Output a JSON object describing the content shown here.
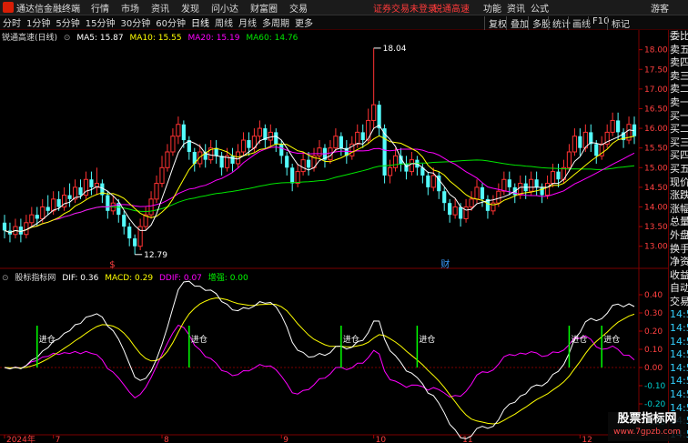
{
  "app": {
    "title": "通达信金融终端",
    "menu": [
      "行情",
      "市场",
      "资讯",
      "发现",
      "问小达",
      "财富圈",
      "交易"
    ],
    "notice": "证券交易未登录",
    "notice2": "锐通高速",
    "right_menu": [
      "功能",
      "资讯",
      "公式",
      "游客"
    ]
  },
  "toolbar": {
    "periods": [
      "分时",
      "1分钟",
      "5分钟",
      "15分钟",
      "30分钟",
      "60分钟",
      "日线",
      "周线",
      "月线",
      "多周期",
      "更多"
    ],
    "active": "日线",
    "right": [
      "复权",
      "叠加",
      "多股",
      "统计",
      "画线",
      "F10",
      "标记"
    ]
  },
  "legend_main": {
    "name": "锐通高速(日线)",
    "ma5": "MA5: 15.87",
    "ma10": "MA10: 15.55",
    "ma20": "MA20: 15.19",
    "ma60": "MA60: 14.76"
  },
  "legend_sub": {
    "name": "股标指标网",
    "dif": "DIF: 0.36",
    "macd": "MACD: 0.29",
    "ddif": "DDIF: 0.07",
    "zq": "增强: 0.00"
  },
  "right_panel": [
    "委比",
    "卖五",
    "卖四",
    "卖三",
    "卖二",
    "卖一",
    "买一",
    "买二",
    "买三",
    "买四",
    "买五",
    "现价",
    "涨跌",
    "涨幅",
    "总量",
    "外盘",
    "换手",
    "净资",
    "收益",
    "自动",
    "交易",
    "14:5",
    "14:5",
    "14:5",
    "14:5",
    "14:5",
    "14:5",
    "14:5",
    "14:5",
    "14:5",
    "14:5"
  ],
  "watermark": {
    "line1": "股票指标网",
    "line2": "www.7gpzb.com"
  },
  "colors": {
    "up": "#ff3232",
    "down": "#54fcfc",
    "ma5": "#ffffff",
    "ma10": "#ffff00",
    "ma20": "#ff00ff",
    "ma60": "#00e600",
    "dif": "#ffffff",
    "dea": "#ffff00",
    "ddif": "#ff00ff",
    "signal": "#00ff00"
  },
  "chart_data": {
    "type": "candlestick",
    "y_ticks": [
      "18.00",
      "17.50",
      "17.00",
      "16.50",
      "16.00",
      "15.50",
      "15.00",
      "14.50",
      "14.00",
      "13.50",
      "13.00"
    ],
    "ylim": [
      12.6,
      18.2
    ],
    "x_ticks": [
      {
        "index": 0,
        "label": "2024年"
      },
      {
        "index": 9,
        "label": "7"
      },
      {
        "index": 29,
        "label": "8"
      },
      {
        "index": 51,
        "label": "9"
      },
      {
        "index": 68,
        "label": "10"
      },
      {
        "index": 84,
        "label": "11"
      },
      {
        "index": 106,
        "label": "12"
      }
    ],
    "high_label": {
      "index": 68,
      "value": "18.04"
    },
    "low_label": {
      "index": 24,
      "value": "12.79"
    },
    "event_markers": [
      {
        "index": 20,
        "label": "$"
      },
      {
        "index": 81,
        "label": "财"
      }
    ],
    "candles": [
      [
        13.6,
        13.4,
        13.8,
        13.2
      ],
      [
        13.4,
        13.3,
        13.6,
        13.1
      ],
      [
        13.3,
        13.5,
        13.7,
        13.2
      ],
      [
        13.5,
        13.3,
        13.7,
        13.1
      ],
      [
        13.3,
        13.6,
        13.8,
        13.2
      ],
      [
        13.6,
        13.8,
        14.0,
        13.5
      ],
      [
        13.8,
        13.7,
        14.0,
        13.5
      ],
      [
        13.7,
        14.0,
        14.2,
        13.6
      ],
      [
        14.0,
        13.9,
        14.3,
        13.8
      ],
      [
        13.9,
        14.2,
        14.4,
        13.8
      ],
      [
        14.2,
        14.0,
        14.4,
        13.9
      ],
      [
        14.0,
        14.3,
        14.5,
        13.9
      ],
      [
        14.3,
        14.2,
        14.6,
        14.0
      ],
      [
        14.2,
        14.5,
        14.7,
        14.1
      ],
      [
        14.5,
        14.3,
        14.7,
        14.2
      ],
      [
        14.3,
        14.7,
        14.9,
        14.2
      ],
      [
        14.7,
        14.5,
        14.9,
        14.3
      ],
      [
        14.5,
        14.6,
        15.0,
        14.3
      ],
      [
        14.6,
        14.3,
        14.7,
        14.1
      ],
      [
        14.3,
        13.9,
        14.4,
        13.7
      ],
      [
        13.9,
        14.1,
        14.3,
        13.8
      ],
      [
        14.1,
        13.8,
        14.2,
        13.6
      ],
      [
        13.8,
        13.5,
        13.9,
        13.3
      ],
      [
        13.5,
        13.2,
        13.6,
        13.0
      ],
      [
        13.2,
        13.0,
        13.3,
        12.79
      ],
      [
        13.0,
        13.5,
        13.7,
        12.9
      ],
      [
        13.5,
        13.8,
        14.0,
        13.4
      ],
      [
        13.8,
        14.2,
        14.4,
        13.7
      ],
      [
        14.2,
        14.6,
        14.8,
        14.1
      ],
      [
        14.6,
        15.0,
        15.3,
        14.5
      ],
      [
        15.0,
        15.4,
        15.6,
        14.9
      ],
      [
        15.4,
        15.8,
        16.0,
        15.3
      ],
      [
        15.8,
        16.1,
        16.3,
        15.6
      ],
      [
        16.1,
        15.7,
        16.2,
        15.5
      ],
      [
        15.7,
        15.4,
        15.8,
        15.2
      ],
      [
        15.4,
        15.1,
        15.5,
        14.9
      ],
      [
        15.1,
        15.4,
        15.6,
        15.0
      ],
      [
        15.4,
        15.2,
        15.6,
        15.0
      ],
      [
        15.2,
        15.5,
        15.7,
        15.1
      ],
      [
        15.5,
        15.3,
        15.7,
        15.1
      ],
      [
        15.3,
        15.0,
        15.4,
        14.8
      ],
      [
        15.0,
        15.3,
        15.5,
        14.9
      ],
      [
        15.3,
        15.1,
        15.5,
        14.9
      ],
      [
        15.1,
        15.4,
        15.6,
        15.0
      ],
      [
        15.4,
        15.7,
        15.9,
        15.3
      ],
      [
        15.7,
        15.5,
        15.9,
        15.3
      ],
      [
        15.5,
        15.8,
        16.0,
        15.4
      ],
      [
        15.8,
        16.0,
        16.2,
        15.6
      ],
      [
        16.0,
        15.7,
        16.1,
        15.5
      ],
      [
        15.7,
        15.9,
        16.1,
        15.5
      ],
      [
        15.9,
        15.6,
        16.0,
        15.4
      ],
      [
        15.6,
        15.3,
        15.7,
        15.1
      ],
      [
        15.3,
        15.0,
        15.4,
        14.8
      ],
      [
        15.0,
        14.6,
        15.1,
        14.4
      ],
      [
        14.6,
        14.9,
        15.1,
        14.5
      ],
      [
        14.9,
        15.2,
        15.4,
        14.8
      ],
      [
        15.2,
        15.0,
        15.4,
        14.8
      ],
      [
        15.0,
        15.3,
        15.5,
        14.9
      ],
      [
        15.3,
        15.5,
        15.7,
        15.2
      ],
      [
        15.5,
        15.2,
        15.6,
        15.0
      ],
      [
        15.2,
        15.5,
        15.7,
        15.1
      ],
      [
        15.5,
        15.8,
        16.0,
        15.4
      ],
      [
        15.8,
        15.5,
        15.9,
        15.3
      ],
      [
        15.5,
        15.3,
        15.7,
        15.1
      ],
      [
        15.3,
        15.6,
        15.8,
        15.2
      ],
      [
        15.6,
        15.9,
        16.1,
        15.5
      ],
      [
        15.9,
        15.7,
        16.1,
        15.5
      ],
      [
        15.7,
        16.2,
        16.5,
        15.6
      ],
      [
        16.2,
        16.6,
        18.04,
        16.0
      ],
      [
        16.6,
        16.0,
        16.7,
        15.8
      ],
      [
        16.0,
        14.8,
        16.1,
        14.6
      ],
      [
        14.8,
        15.0,
        15.2,
        14.6
      ],
      [
        15.0,
        15.3,
        15.5,
        14.9
      ],
      [
        15.3,
        15.1,
        15.5,
        14.9
      ],
      [
        15.1,
        14.9,
        15.3,
        14.7
      ],
      [
        14.9,
        15.2,
        15.4,
        14.8
      ],
      [
        15.2,
        15.0,
        15.3,
        14.8
      ],
      [
        15.0,
        14.8,
        15.1,
        14.6
      ],
      [
        14.8,
        14.5,
        14.9,
        14.3
      ],
      [
        14.5,
        14.8,
        15.0,
        14.4
      ],
      [
        14.8,
        14.4,
        14.9,
        14.2
      ],
      [
        14.4,
        14.1,
        14.5,
        13.9
      ],
      [
        14.1,
        13.8,
        14.2,
        13.6
      ],
      [
        13.8,
        14.0,
        14.2,
        13.7
      ],
      [
        14.0,
        13.7,
        14.1,
        13.5
      ],
      [
        13.7,
        14.0,
        14.2,
        13.6
      ],
      [
        14.0,
        14.2,
        14.4,
        13.9
      ],
      [
        14.2,
        14.5,
        14.7,
        14.1
      ],
      [
        14.5,
        14.2,
        14.6,
        14.0
      ],
      [
        14.2,
        13.9,
        14.3,
        13.7
      ],
      [
        13.9,
        14.1,
        14.3,
        13.8
      ],
      [
        14.1,
        14.4,
        14.6,
        14.0
      ],
      [
        14.4,
        14.7,
        14.9,
        14.3
      ],
      [
        14.7,
        14.5,
        14.9,
        14.3
      ],
      [
        14.5,
        14.3,
        14.6,
        14.1
      ],
      [
        14.3,
        14.6,
        14.8,
        14.2
      ],
      [
        14.6,
        14.4,
        14.8,
        14.2
      ],
      [
        14.4,
        14.7,
        14.9,
        14.3
      ],
      [
        14.7,
        14.5,
        14.9,
        14.3
      ],
      [
        14.5,
        14.3,
        14.6,
        14.1
      ],
      [
        14.3,
        14.6,
        14.8,
        14.2
      ],
      [
        14.6,
        14.9,
        15.1,
        14.5
      ],
      [
        14.9,
        14.7,
        15.1,
        14.5
      ],
      [
        14.7,
        15.0,
        15.2,
        14.6
      ],
      [
        15.0,
        15.4,
        15.6,
        14.9
      ],
      [
        15.4,
        15.8,
        16.0,
        15.3
      ],
      [
        15.8,
        15.5,
        16.0,
        15.3
      ],
      [
        15.5,
        15.9,
        16.1,
        15.4
      ],
      [
        15.9,
        15.6,
        16.1,
        15.4
      ],
      [
        15.6,
        15.3,
        15.7,
        15.1
      ],
      [
        15.3,
        15.6,
        15.8,
        15.2
      ],
      [
        15.6,
        15.9,
        16.1,
        15.5
      ],
      [
        15.9,
        16.2,
        16.4,
        15.8
      ],
      [
        16.2,
        15.9,
        16.4,
        15.7
      ],
      [
        15.9,
        15.7,
        16.0,
        15.5
      ],
      [
        15.7,
        16.1,
        16.3,
        15.6
      ],
      [
        16.1,
        15.8,
        16.3,
        15.6
      ]
    ],
    "macd": {
      "y_ticks": [
        "0.40",
        "0.30",
        "0.20",
        "0.10",
        "0.00",
        "-0.10",
        "-0.20",
        "-0.30"
      ],
      "ylim": [
        -0.36,
        0.46
      ],
      "signals": [
        {
          "index": 6,
          "label": "进仓"
        },
        {
          "index": 34,
          "label": "进仓"
        },
        {
          "index": 62,
          "label": "进仓"
        },
        {
          "index": 76,
          "label": "进仓"
        },
        {
          "index": 104,
          "label": "进仓"
        },
        {
          "index": 110,
          "label": "进仓"
        }
      ]
    }
  }
}
